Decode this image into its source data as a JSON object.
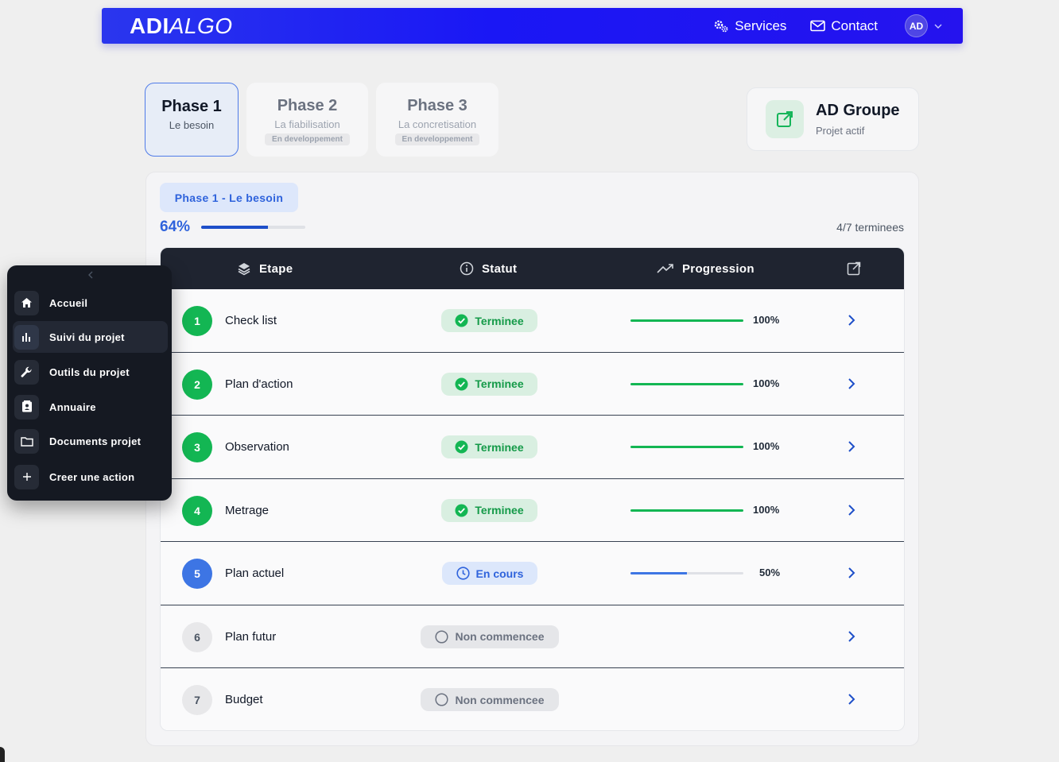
{
  "header": {
    "logo_bold": "ADI",
    "logo_italic": "ALGO",
    "nav": [
      {
        "label": "Services",
        "icon": "gears-icon"
      },
      {
        "label": "Contact",
        "icon": "mail-icon"
      }
    ],
    "avatar_initials": "AD"
  },
  "phases": [
    {
      "title": "Phase 1",
      "subtitle": "Le besoin",
      "badge": "",
      "active": true
    },
    {
      "title": "Phase 2",
      "subtitle": "La fiabilisation",
      "badge": "En developpement",
      "active": false
    },
    {
      "title": "Phase 3",
      "subtitle": "La concretisation",
      "badge": "En developpement",
      "active": false
    }
  ],
  "project": {
    "name": "AD Groupe",
    "status": "Projet actif",
    "icon": "external-link-icon"
  },
  "panel": {
    "phase_label": "Phase 1 - Le besoin",
    "percent_label": "64%",
    "percent_value": 64,
    "done_count": "4/7 terminees"
  },
  "table": {
    "headers": {
      "step": "Etape",
      "status": "Statut",
      "progress": "Progression"
    },
    "rows": [
      {
        "num": "1",
        "name": "Check list",
        "status": "Terminee",
        "state": "done",
        "progress_label": "100%",
        "progress": 100
      },
      {
        "num": "2",
        "name": "Plan d'action",
        "status": "Terminee",
        "state": "done",
        "progress_label": "100%",
        "progress": 100
      },
      {
        "num": "3",
        "name": "Observation",
        "status": "Terminee",
        "state": "done",
        "progress_label": "100%",
        "progress": 100
      },
      {
        "num": "4",
        "name": "Metrage",
        "status": "Terminee",
        "state": "done",
        "progress_label": "100%",
        "progress": 100
      },
      {
        "num": "5",
        "name": "Plan actuel",
        "status": "En cours",
        "state": "progress",
        "progress_label": "50%",
        "progress": 50
      },
      {
        "num": "6",
        "name": "Plan futur",
        "status": "Non commencee",
        "state": "todo",
        "progress_label": "",
        "progress": 0
      },
      {
        "num": "7",
        "name": "Budget",
        "status": "Non commencee",
        "state": "todo",
        "progress_label": "",
        "progress": 0
      }
    ]
  },
  "sidebar": {
    "items": [
      {
        "label": "Accueil",
        "icon": "home-icon"
      },
      {
        "label": "Suivi du projet",
        "icon": "bar-chart-icon"
      },
      {
        "label": "Outils du projet",
        "icon": "wrench-icon"
      },
      {
        "label": "Annuaire",
        "icon": "contact-book-icon"
      },
      {
        "label": "Documents projet",
        "icon": "folder-icon"
      },
      {
        "label": "Creer une action",
        "icon": "plus-icon"
      }
    ]
  },
  "colors": {
    "brand_blue": "#1a17f5",
    "accent_blue": "#2f63dc",
    "success_green": "#13b653",
    "dark_header": "#1f2430"
  }
}
